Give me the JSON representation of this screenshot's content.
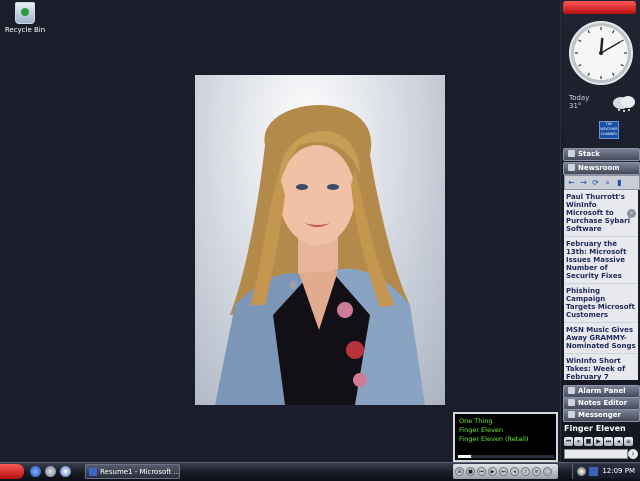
{
  "desktop": {
    "icons": [
      {
        "label": "Recycle Bin",
        "icon": "recycle-bin-icon"
      }
    ],
    "background_color": "#1b1d2a"
  },
  "sidebar": {
    "weather": {
      "day": "Today",
      "temperature": "31°",
      "icon": "cloudy-snow-icon",
      "provider_logo": "THE WEATHER CHANNEL"
    },
    "clock": {
      "hour": 12,
      "minute": 10
    },
    "tiles": {
      "stack": "Stack",
      "newsroom": "Newsroom",
      "alarm": "Alarm Panel",
      "notes": "Notes Editor v2",
      "messenger": "Messenger"
    },
    "news_items": [
      "Paul Thurrott's WinInfo Microsoft to Purchase Sybari Software",
      "February the 13th: Microsoft Issues Massive Number of Security Fixes",
      "Phishing Campaign Targets Microsoft Customers",
      "MSN Music Gives Away GRAMMY-Nominated Songs",
      "WinInfo Short Takes: Week of February 7"
    ],
    "now_playing": {
      "artist": "Finger Eleven",
      "buttons": [
        "prev",
        "pause",
        "stop",
        "play",
        "next",
        "vol"
      ]
    }
  },
  "popup": {
    "lines": [
      "One Thing",
      "Finger Eleven",
      "Finger Eleven (Retail)"
    ],
    "progress": 0.14
  },
  "taskbar": {
    "task_label": "Resume1 - Microsoft ...",
    "clock": "12:09 PM",
    "quick_launch": [
      "ie-icon",
      "desktop-icon",
      "media-player-icon"
    ]
  },
  "colors": {
    "accent_red": "#d81c1c",
    "popup_text": "#6df02f",
    "news_text": "#1f2a5c"
  }
}
